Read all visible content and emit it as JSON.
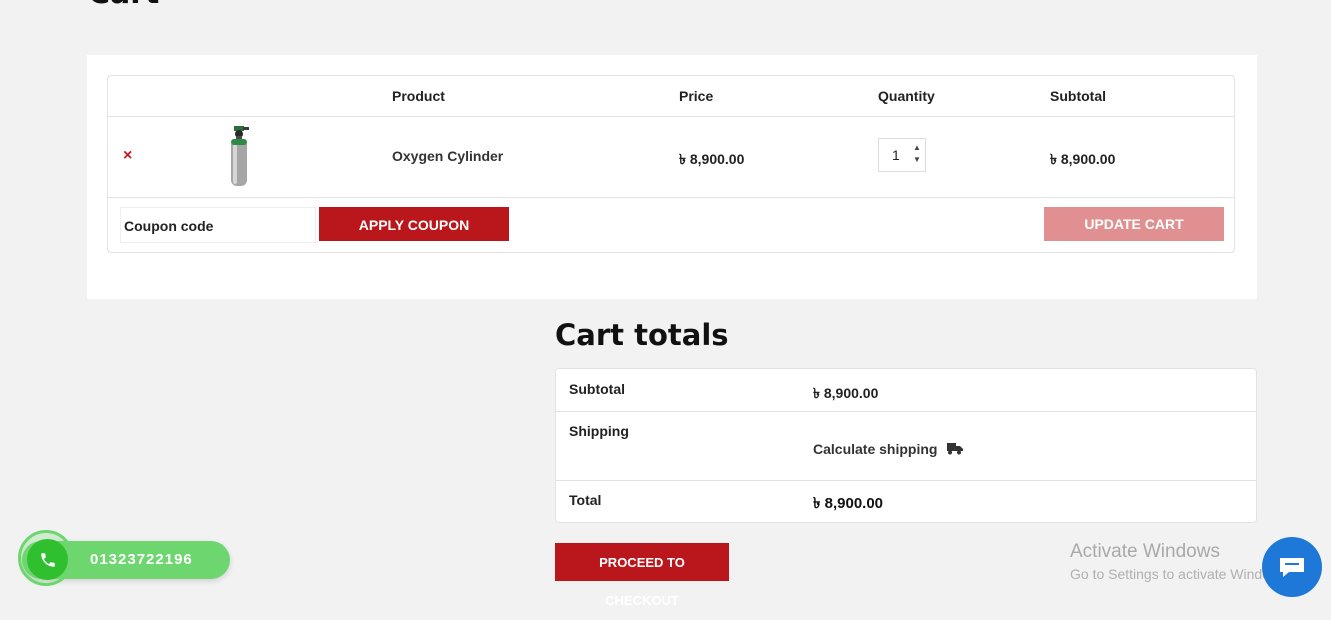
{
  "page": {
    "title": "Cart"
  },
  "cart_table": {
    "headers": {
      "product": "Product",
      "price": "Price",
      "quantity": "Quantity",
      "subtotal": "Subtotal"
    },
    "items": [
      {
        "remove": "×",
        "name": "Oxygen Cylinder",
        "price": "৳ 8,900.00",
        "quantity": "1",
        "subtotal": "৳ 8,900.00"
      }
    ]
  },
  "coupon": {
    "placeholder": "Coupon code",
    "apply_label": "APPLY COUPON"
  },
  "update_cart_label": "UPDATE CART",
  "totals": {
    "title": "Cart totals",
    "subtotal_label": "Subtotal",
    "subtotal_value": "৳ 8,900.00",
    "shipping_label": "Shipping",
    "shipping_link": "Calculate shipping",
    "total_label": "Total",
    "total_value": "৳ 8,900.00"
  },
  "checkout_label": "PROCEED TO CHECKOUT",
  "call_widget": {
    "number": "01323722196"
  },
  "watermark": {
    "title": "Activate Windows",
    "subtitle": "Go to Settings to activate Windows."
  },
  "colors": {
    "accent": "#b9171c",
    "update_disabled": "#e09091",
    "call_green": "#6ed66e",
    "chat_blue": "#1e78d8"
  },
  "icons": [
    "remove-icon",
    "phone-icon",
    "truck-icon",
    "chat-icon",
    "spin-up-icon",
    "spin-down-icon"
  ]
}
